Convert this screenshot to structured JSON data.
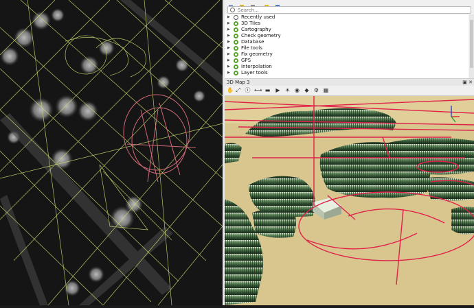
{
  "search": {
    "placeholder": "Search..."
  },
  "toolbox": {
    "items": [
      {
        "label": "Recently used",
        "icon": "clock-icon"
      },
      {
        "label": "3D Tiles",
        "icon": "qgis-icon"
      },
      {
        "label": "Cartography",
        "icon": "qgis-icon"
      },
      {
        "label": "Check geometry",
        "icon": "qgis-icon"
      },
      {
        "label": "Database",
        "icon": "qgis-icon"
      },
      {
        "label": "File tools",
        "icon": "qgis-icon"
      },
      {
        "label": "Fix geometry",
        "icon": "qgis-icon"
      },
      {
        "label": "GPS",
        "icon": "qgis-icon"
      },
      {
        "label": "Interpolation",
        "icon": "qgis-icon"
      },
      {
        "label": "Layer tools",
        "icon": "qgis-icon"
      }
    ]
  },
  "view3d": {
    "title": "3D Map 3",
    "close_glyph": "✕",
    "tools": [
      "pan-icon",
      "zoom-full-icon",
      "identify-icon",
      "measure-icon",
      "animation-icon",
      "play-icon",
      "sun-icon",
      "camera-icon",
      "effects-icon",
      "settings-icon",
      "layers-icon"
    ]
  },
  "colors": {
    "grid_line": "#c8d86e",
    "track_line": "#e0204a",
    "terrain": "#d8c68e",
    "trees": "#3f6e3c",
    "accent_green": "#59a52c"
  }
}
